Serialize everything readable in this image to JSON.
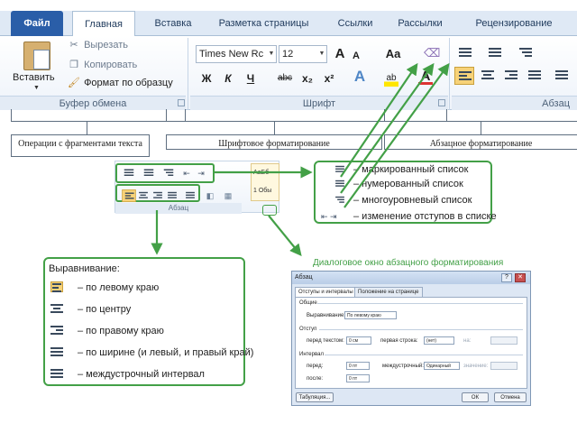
{
  "tabs": {
    "file": "Файл",
    "home": "Главная",
    "insert": "Вставка",
    "layout": "Разметка страницы",
    "refs": "Ссылки",
    "mail": "Рассылки",
    "review": "Рецензирование"
  },
  "clipboard": {
    "paste": "Вставить",
    "cut": "Вырезать",
    "copy": "Копировать",
    "format_painter": "Формат по образцу",
    "caption": "Буфер обмена"
  },
  "font": {
    "name": "Times New Rc",
    "size": "12",
    "grow": "A",
    "shrink": "A",
    "change_case": "Aa",
    "bold": "Ж",
    "italic": "К",
    "underline": "Ч",
    "strike": "abc",
    "subscript": "x₂",
    "superscript": "x²",
    "text_effects": "A",
    "highlight": "ab",
    "font_color": "A",
    "caption": "Шрифт"
  },
  "paragraph": {
    "caption": "Абзац"
  },
  "annotations": {
    "clipboard": "Операции с фрагментами текста",
    "font": "Шрифтовое форматирование",
    "paragraph": "Абзацное форматирование"
  },
  "mini_panel": {
    "caption": "Абзац",
    "style_sample_1": "АаБб",
    "style_sample_2": "1 Обы"
  },
  "lists_callout": {
    "items": [
      "– маркированный список",
      "– нумерованный список",
      "– многоуровневый список",
      "– изменение отступов в списке"
    ]
  },
  "align_callout": {
    "title": "Выравнивание:",
    "items": [
      "– по левому краю",
      "– по центру",
      "– по правому краю",
      "– по ширине (и левый, и правый край)",
      "– междустрочный интервал"
    ]
  },
  "dialog": {
    "caption": "Диалоговое окно абзацного форматирования",
    "title": "Абзац",
    "help": "?",
    "close": "✕",
    "tab_indents": "Отступы и интервалы",
    "tab_position": "Положение на странице",
    "general_section": "Общие",
    "alignment_label": "Выравнивание:",
    "alignment_value": "По левому краю",
    "indent_section": "Отступ",
    "indent_left_label": "перед текстом:",
    "indent_left_value": "0 см",
    "first_line_label": "первая строка:",
    "first_line_value": "(нет)",
    "first_line_by_label": "на:",
    "spacing_section": "Интервал",
    "before_label": "перед:",
    "before_value": "0 пт",
    "after_label": "после:",
    "after_value": "0 пт",
    "line_spacing_label": "междустрочный:",
    "line_spacing_value": "Одинарный",
    "line_value_label": "значение:",
    "tabs_button": "Табуляция...",
    "ok_button": "ОК",
    "cancel_button": "Отмена"
  },
  "colors": {
    "accent_green": "#43a047",
    "file_tab": "#2a5ea8",
    "active_align": "#f7d278"
  }
}
